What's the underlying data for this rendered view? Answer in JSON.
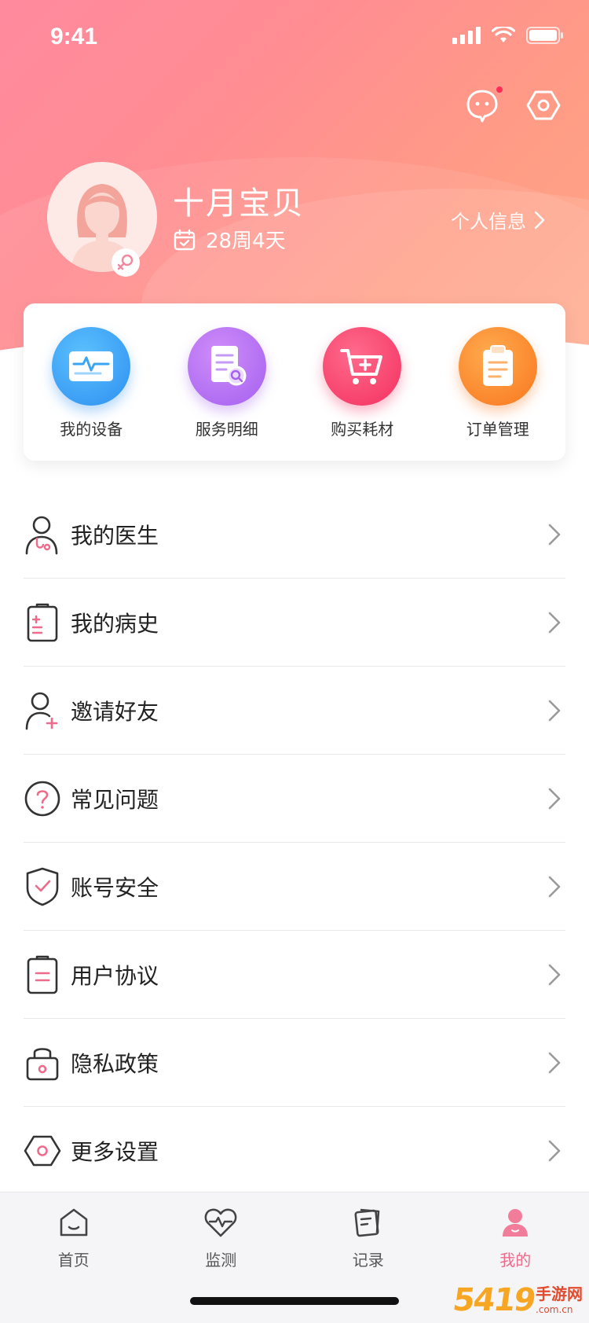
{
  "status_bar": {
    "time": "9:41"
  },
  "profile": {
    "name": "十月宝贝",
    "pregnancy_week": "28周4天",
    "info_link_label": "个人信息"
  },
  "quick_actions": [
    {
      "label": "我的设备",
      "icon": "device-monitor-icon",
      "color": "#3aa6f3"
    },
    {
      "label": "服务明细",
      "icon": "service-detail-icon",
      "color": "#b06cf3"
    },
    {
      "label": "购买耗材",
      "icon": "shopping-cart-icon",
      "color": "#f8436b"
    },
    {
      "label": "订单管理",
      "icon": "order-clipboard-icon",
      "color": "#fb8a2c"
    }
  ],
  "menu": [
    {
      "label": "我的医生",
      "icon": "doctor-icon"
    },
    {
      "label": "我的病史",
      "icon": "medical-record-icon"
    },
    {
      "label": "邀请好友",
      "icon": "invite-friend-icon"
    },
    {
      "label": "常见问题",
      "icon": "question-icon"
    },
    {
      "label": "账号安全",
      "icon": "shield-check-icon"
    },
    {
      "label": "用户协议",
      "icon": "agreement-icon"
    },
    {
      "label": "隐私政策",
      "icon": "lock-icon"
    },
    {
      "label": "更多设置",
      "icon": "settings-icon"
    }
  ],
  "tab_bar": {
    "tabs": [
      {
        "label": "首页",
        "icon": "home-icon"
      },
      {
        "label": "监测",
        "icon": "heart-monitor-icon"
      },
      {
        "label": "记录",
        "icon": "record-icon"
      },
      {
        "label": "我的",
        "icon": "profile-icon",
        "active": true
      }
    ]
  },
  "watermark": {
    "number": "5419",
    "text_cn": "手游网",
    "domain": ".com.cn"
  },
  "colors": {
    "accent": "#ee6b8b",
    "hero_start": "#ff8a9e",
    "hero_end": "#ffa889"
  }
}
